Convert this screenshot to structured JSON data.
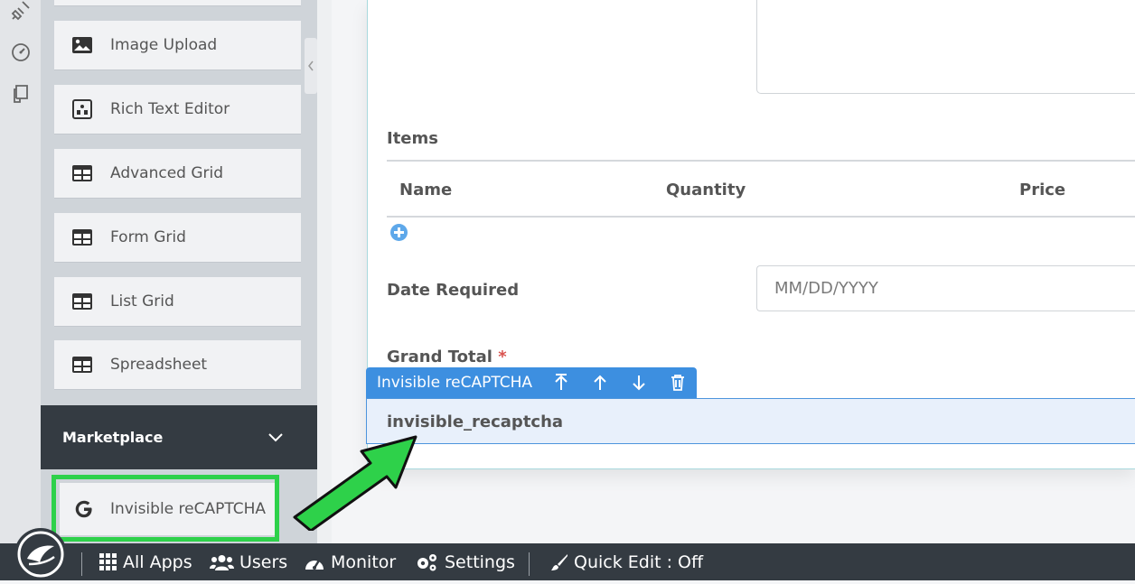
{
  "palette": {
    "items": [
      {
        "label": "Image Upload",
        "icon": "image-icon"
      },
      {
        "label": "Rich Text Editor",
        "icon": "rich-text-icon"
      },
      {
        "label": "Advanced Grid",
        "icon": "grid-icon"
      },
      {
        "label": "Form Grid",
        "icon": "grid-icon"
      },
      {
        "label": "List Grid",
        "icon": "grid-icon"
      },
      {
        "label": "Spreadsheet",
        "icon": "grid-icon"
      }
    ],
    "section_title": "Marketplace",
    "marketplace_item": {
      "label": "Invisible reCAPTCHA",
      "icon": "google-icon"
    }
  },
  "form": {
    "items_label": "Items",
    "columns": [
      "Name",
      "Quantity",
      "Price"
    ],
    "date_label": "Date Required",
    "date_placeholder": "MM/DD/YYYY",
    "grand_total_label": "Grand Total",
    "required_mark": "*",
    "selected_field": {
      "toolbar_label": "Invisible reCAPTCHA",
      "field_name": "invisible_recaptcha"
    }
  },
  "bottombar": {
    "all_apps": "All Apps",
    "users": "Users",
    "monitor": "Monitor",
    "settings": "Settings",
    "quick_edit": "Quick Edit : Off"
  },
  "colors": {
    "highlight": "#2ed14a",
    "accent": "#3d8fe0",
    "dark": "#343b42"
  }
}
